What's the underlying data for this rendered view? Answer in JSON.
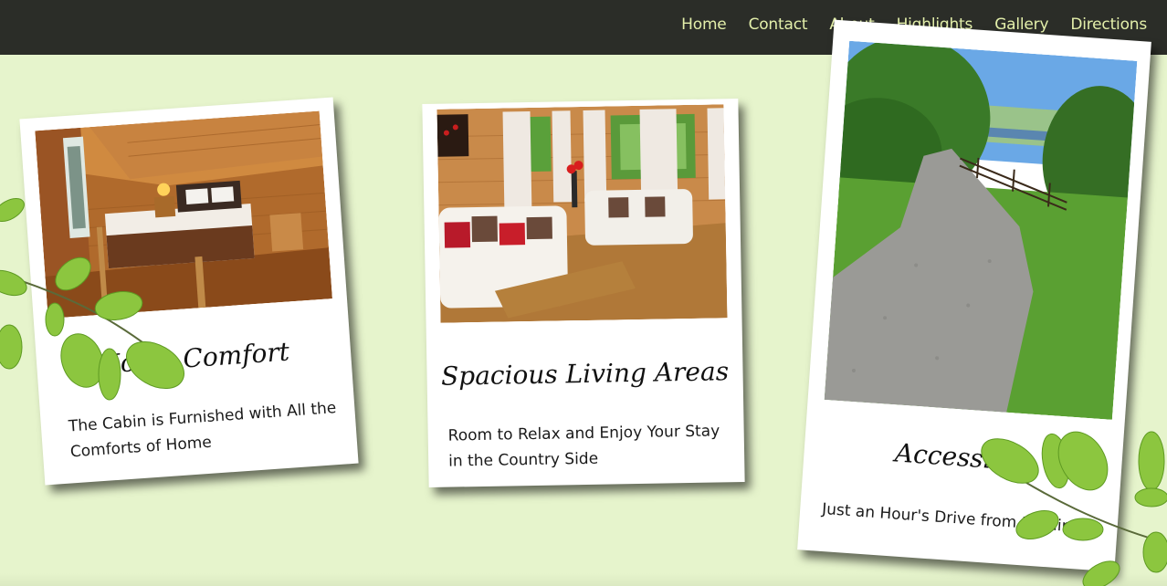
{
  "nav": {
    "items": [
      {
        "label": "Home"
      },
      {
        "label": "Contact"
      },
      {
        "label": "About"
      },
      {
        "label": "Highlights"
      },
      {
        "label": "Gallery"
      },
      {
        "label": "Directions"
      }
    ]
  },
  "cards": [
    {
      "title": "Home Comfort",
      "text": "The Cabin is Furnished with All the Comforts of Home"
    },
    {
      "title": "Spacious Living Areas",
      "text": "Room to Relax and Enjoy Your Stay in the Country Side"
    },
    {
      "title": "Accessible",
      "text": "Just an Hour's Drive from Dublin"
    }
  ],
  "colors": {
    "background": "#e6f4cc",
    "navbar": "#2b2d28",
    "nav_text": "#e3efaa",
    "card": "#ffffff",
    "leaf": "#8cc63f"
  },
  "icons": [
    "leaf-branch"
  ]
}
